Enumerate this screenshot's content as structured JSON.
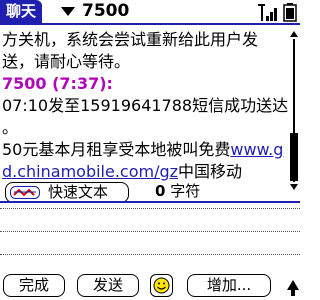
{
  "header": {
    "title": "聊天",
    "contact": "7500"
  },
  "messages": {
    "line1": "方关机，系统会尝试重新给此用户发",
    "line2": "送，请耐心等待。",
    "sender": "7500 (7:37):",
    "line4": "07:10发至15919641788短信成功送达",
    "line5": "。",
    "line6_text": "50元基本月租享受本地被叫免费",
    "line6_link": "www.g",
    "line7_link": "d.chinamobile.com/gz",
    "line7_text": "中国移动"
  },
  "quick_text": {
    "label": "快速文本",
    "count": "0",
    "count_unit": "字符"
  },
  "toolbar": {
    "done": "完成",
    "send": "发送",
    "add": "增加..."
  },
  "colors": {
    "accent": "#1f1fb0",
    "sender": "#b008b8"
  }
}
